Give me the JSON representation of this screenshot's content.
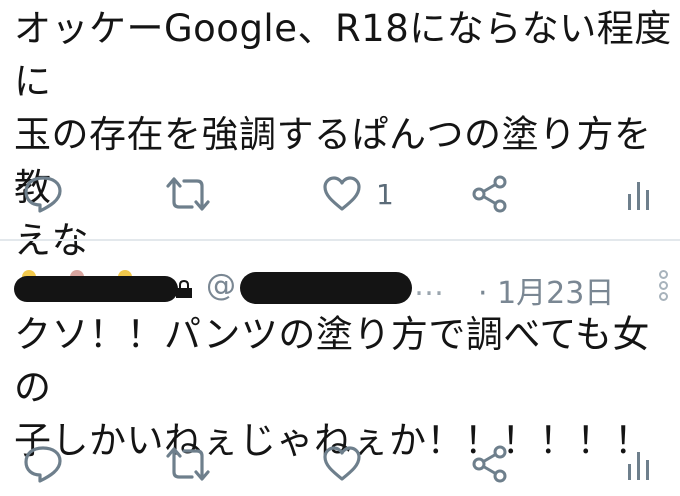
{
  "tweets": [
    {
      "text": "オッケーGoogle、R18にならない程度に\n玉の存在を強調するぱんつの塗り方を教\nえな",
      "actions": {
        "reply_icon": "reply-icon",
        "retweet_icon": "retweet-icon",
        "like_icon": "heart-icon",
        "like_count": "1",
        "share_icon": "share-icon",
        "analytics_icon": "analytics-icon"
      }
    },
    {
      "handle_prefix": "@",
      "ellipsis": "…",
      "date": "· 1月23日",
      "text": "クソ！！パンツの塗り方で調べても女の\n子しかいねぇじゃねぇか！！！！！！",
      "actions": {
        "reply_icon": "reply-icon",
        "retweet_icon": "retweet-icon",
        "like_icon": "heart-icon",
        "share_icon": "share-icon",
        "analytics_icon": "analytics-icon"
      }
    }
  ],
  "colors": {
    "icon_gray": "#6e7f8c",
    "text": "#141414",
    "meta_gray": "#7a8793",
    "divider": "#e3e8ec",
    "redaction": "#141414"
  }
}
